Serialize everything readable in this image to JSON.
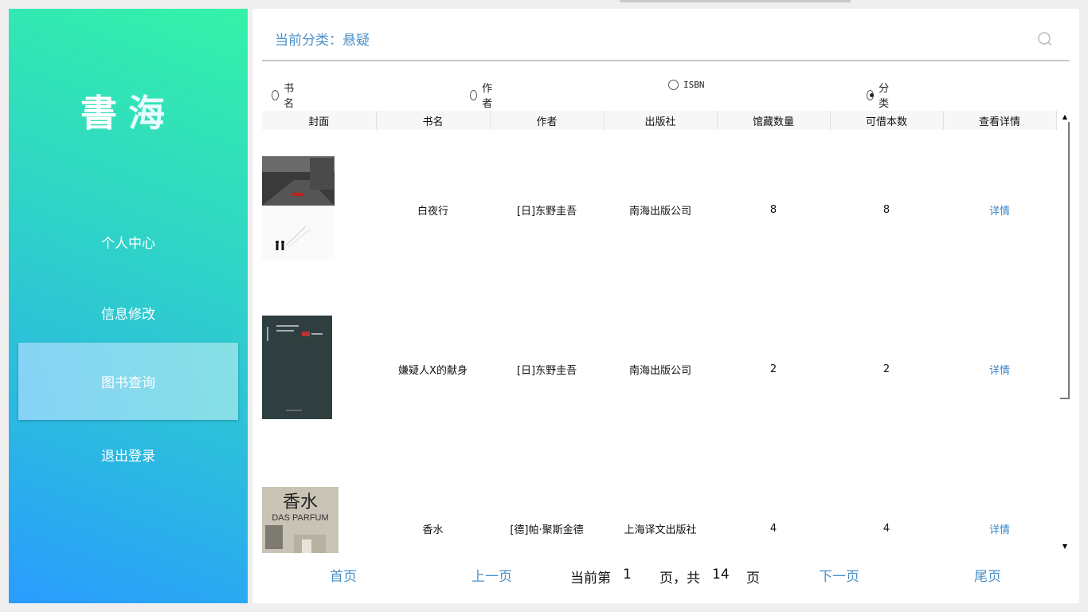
{
  "sidebar": {
    "logo_char1": "書",
    "logo_char2": "海",
    "items": [
      {
        "label": "个人中心"
      },
      {
        "label": "信息修改"
      },
      {
        "label": "图书查询",
        "active": true
      },
      {
        "label": "退出登录"
      }
    ]
  },
  "header": {
    "category_title": "当前分类：悬疑"
  },
  "search_options": [
    {
      "label": "书名",
      "checked": false
    },
    {
      "label": "作者",
      "checked": false
    },
    {
      "label": "ISBN",
      "checked": false
    },
    {
      "label": "分类",
      "checked": true
    }
  ],
  "table": {
    "columns": [
      "封面",
      "书名",
      "作者",
      "出版社",
      "馆藏数量",
      "可借本数",
      "查看详情"
    ],
    "rows": [
      {
        "title": "白夜行",
        "author": "[日]东野圭吾",
        "publisher": "南海出版公司",
        "stock": "8",
        "available": "8",
        "detail": "详情"
      },
      {
        "title": "嫌疑人X的献身",
        "author": "[日]东野圭吾",
        "publisher": "南海出版公司",
        "stock": "2",
        "available": "2",
        "detail": "详情"
      },
      {
        "title": "香水",
        "author": "[德]帕·聚斯金德",
        "publisher": "上海译文出版社",
        "stock": "4",
        "available": "4",
        "detail": "详情"
      }
    ],
    "cover3_text": "香水",
    "cover3_sub": "DAS PARFUM"
  },
  "pagination": {
    "first": "首页",
    "prev": "上一页",
    "current_prefix": "当前第",
    "current_page": "1",
    "middle": "页，共",
    "total_pages": "14",
    "suffix": "页",
    "next": "下一页",
    "last": "尾页"
  },
  "colors": {
    "accent": "#4a90c8",
    "sidebar_top": "#34f2a8",
    "sidebar_bottom": "#2a9cff"
  }
}
